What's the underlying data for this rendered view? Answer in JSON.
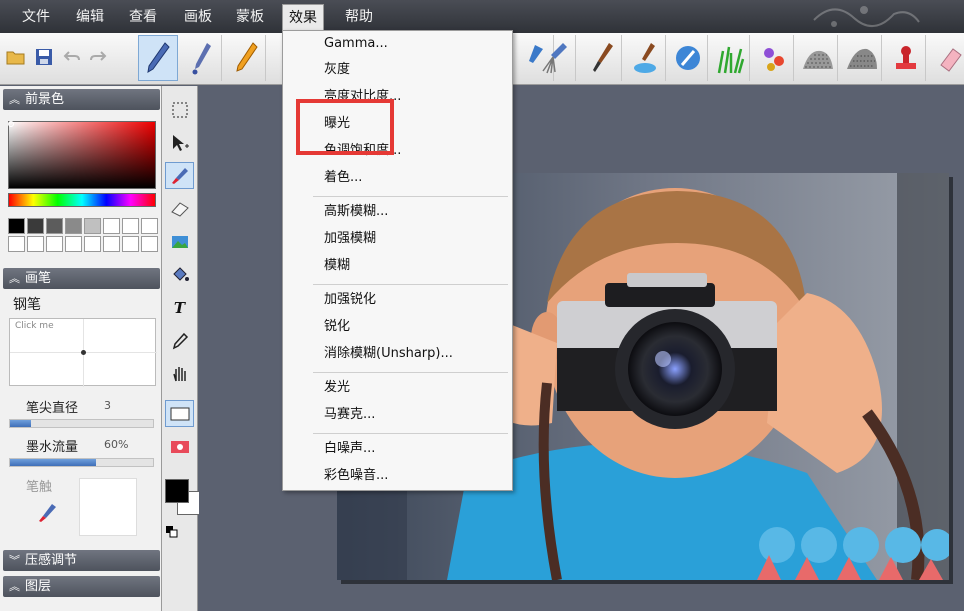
{
  "menu_bar": {
    "items": [
      {
        "label": "文件"
      },
      {
        "label": "编辑"
      },
      {
        "label": "查看"
      },
      {
        "label": "画板"
      },
      {
        "label": "蒙板"
      },
      {
        "label": "效果",
        "active": true
      },
      {
        "label": "帮助"
      }
    ]
  },
  "toolbar": {
    "buttons": [
      "open-folder-icon",
      "save-icon",
      "undo-icon",
      "redo-icon"
    ],
    "brushes": [
      "pen-brush",
      "calligraphy-brush",
      "pencil-brush",
      "fan-brush",
      "paint-brush",
      "palette-knife-brush",
      "airbrush",
      "grass-brush",
      "flower-brush",
      "texture-brush",
      "texture-brush-2",
      "stamp-brush",
      "eraser-brush"
    ]
  },
  "left_panel": {
    "foreground_header": "前景色",
    "brush_header": "画笔",
    "brush_name": "钢笔",
    "brush_pad_hint": "Click me",
    "tip_diameter_label": "笔尖直径",
    "tip_diameter_value": "3",
    "tip_diameter_fraction": 0.15,
    "ink_flow_label": "墨水流量",
    "ink_flow_value": "60%",
    "ink_flow_fraction": 0.6,
    "tip_label": "笔触",
    "pressure_header": "压感调节",
    "layers_header": "图层",
    "swatches": [
      "#000000",
      "#3a3a3a",
      "#5c5c5c",
      "#8a8a8a",
      "#c0c0c0",
      "#ffffff",
      "#ffffff",
      "#ffffff",
      "#ffffff",
      "#ffffff",
      "#ffffff",
      "#ffffff",
      "#ffffff",
      "#ffffff",
      "#ffffff",
      "#ffffff"
    ]
  },
  "tools": [
    "selection-tool",
    "move-tool",
    "brush-tool",
    "eraser-tool",
    "image-tool",
    "fill-tool",
    "text-tool",
    "eyedropper-tool",
    "hand-tool",
    "rectangle-shape",
    "ellipse-shape"
  ],
  "colors": {
    "foreground": "#000000",
    "background": "#ffffff"
  },
  "effects_menu": {
    "items": [
      {
        "label": "Gamma..."
      },
      {
        "label": "灰度"
      },
      {
        "label": "亮度对比度..."
      },
      {
        "label": "曝光",
        "highlighted": true
      },
      {
        "label": "色调饱和度..."
      },
      {
        "label": "着色..."
      },
      {
        "label": "高斯模糊..."
      },
      {
        "label": "加强模糊"
      },
      {
        "label": "模糊"
      },
      {
        "label": "加强锐化"
      },
      {
        "label": "锐化"
      },
      {
        "label": "消除模糊(Unsharp)..."
      },
      {
        "label": "发光"
      },
      {
        "label": "马赛克..."
      },
      {
        "label": "白噪声..."
      },
      {
        "label": "彩色噪音..."
      }
    ]
  }
}
